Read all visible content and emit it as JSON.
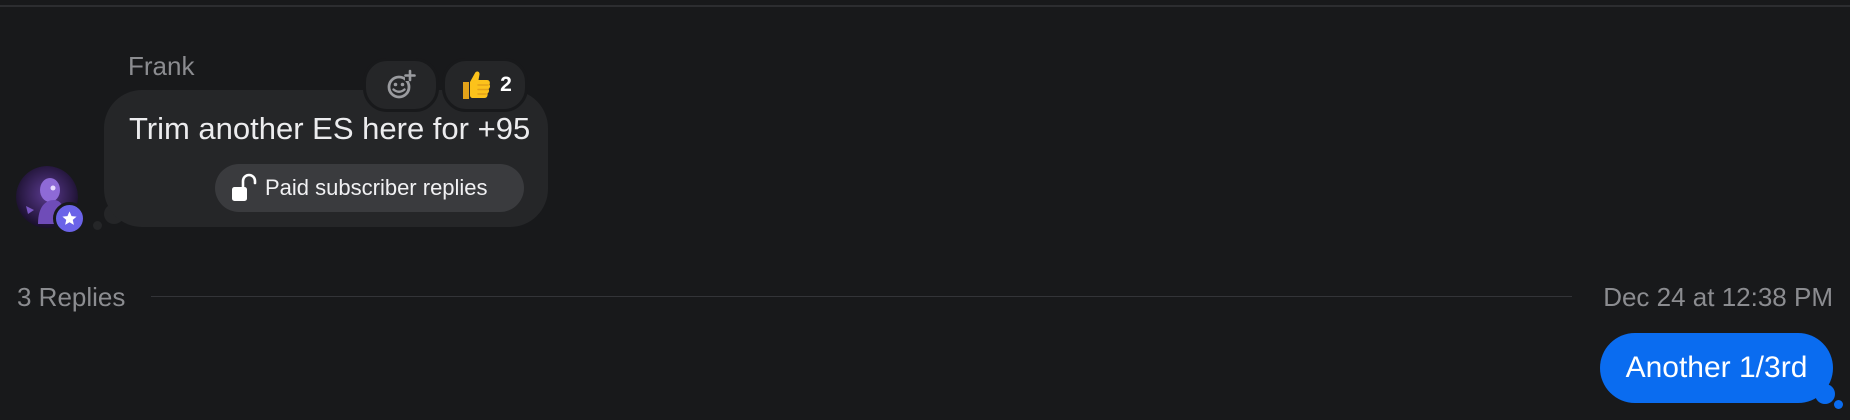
{
  "thread": {
    "message": {
      "sender": "Frank",
      "text": "Trim another ES here for +95",
      "paid_label": "Paid subscriber replies",
      "reactions": {
        "add_icon": "add-reaction-icon",
        "thumbs_up_emoji": "thumbs-up",
        "thumbs_up_count": "2"
      },
      "avatar_icon": "user-avatar",
      "badge_icon": "star-icon"
    },
    "replies": {
      "count_label": "3 Replies",
      "timestamp": "Dec 24 at 12:38 PM"
    },
    "outgoing": {
      "text": "Another 1/3rd"
    }
  },
  "colors": {
    "background": "#18191b",
    "bubble": "#252628",
    "chip": "#3a3b3e",
    "outgoing_bubble": "#0a6cf0",
    "badge": "#6b63e8",
    "muted_text": "#8b8c90"
  }
}
